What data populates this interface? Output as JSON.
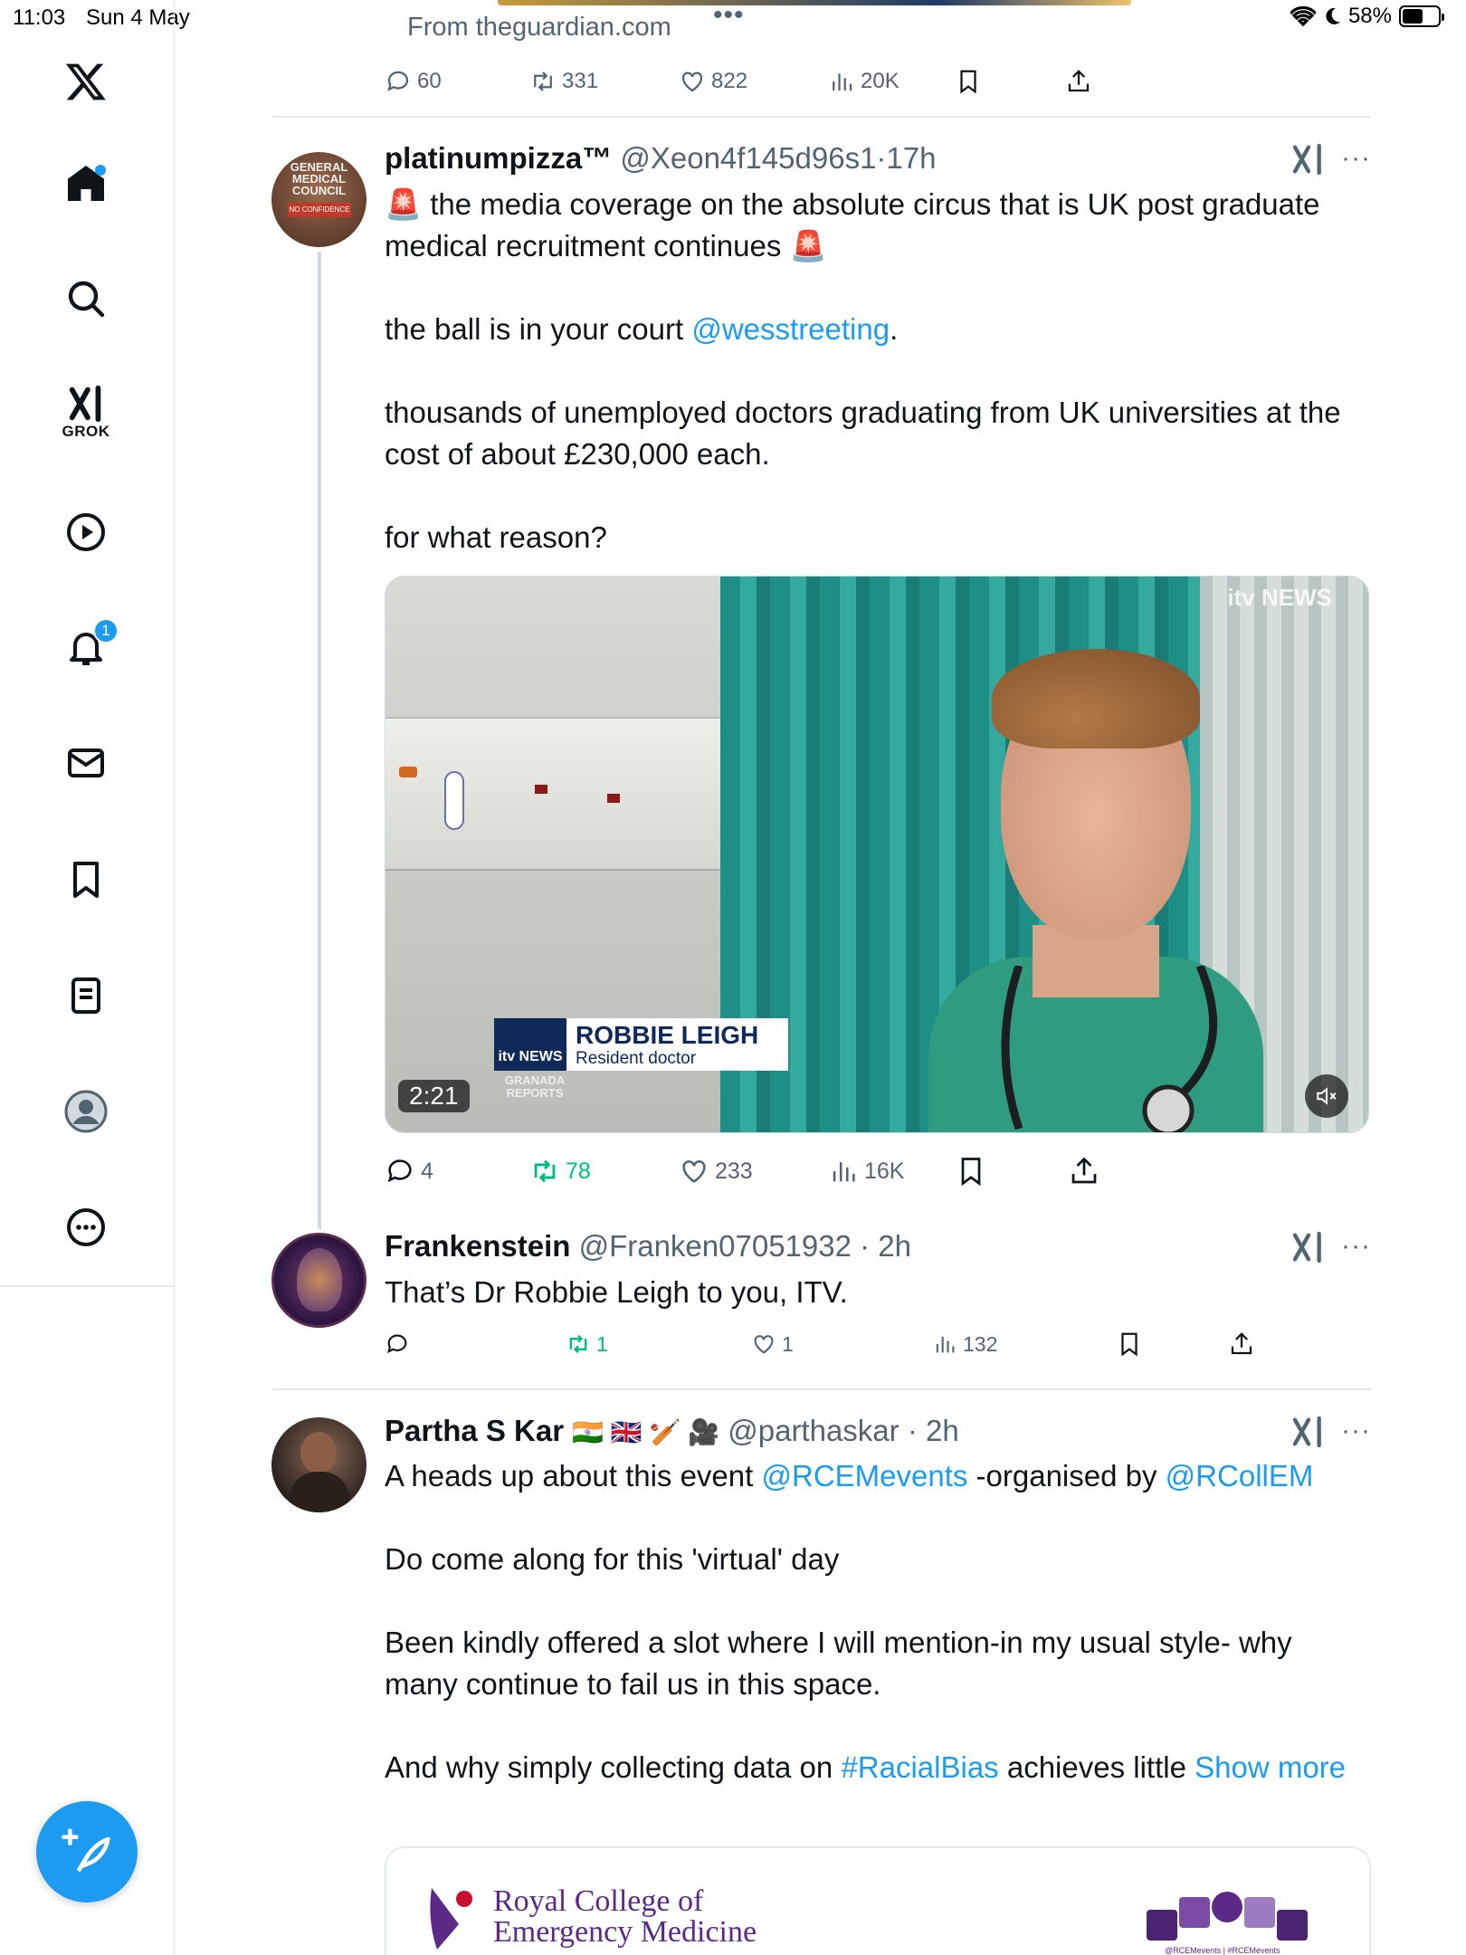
{
  "status": {
    "time": "11:03",
    "date": "Sun 4 May",
    "battery": "58%"
  },
  "sidebar": {
    "grok_label": "GROK",
    "notifications_count": "1"
  },
  "top_tweet": {
    "link_source": "From theguardian.com",
    "replies": "60",
    "reposts": "331",
    "likes": "822",
    "views": "20K"
  },
  "tweet1": {
    "name": "platinumpizza™",
    "handle": "@Xeon4f145d96s1",
    "time": "17h",
    "line1_pre": "🚨 the media coverage on the absolute circus that is UK post graduate",
    "line1_post": "medical recruitment continues 🚨",
    "p2_pre": "the ball is in your court ",
    "p2_link": "@wesstreeting",
    "p2_post": ".",
    "p3": "thousands of unemployed doctors graduating from UK universities at the cost of about £230,000 each.",
    "p4": "for what reason?",
    "video": {
      "duration": "2:21",
      "lower_third_name": "ROBBIE LEIGH",
      "lower_third_role": "Resident doctor",
      "channel": "itv NEWS",
      "sub_channel": "GRANADA REPORTS",
      "watermark": "itv NEWS"
    },
    "replies": "4",
    "reposts": "78",
    "likes": "233",
    "views": "16K"
  },
  "tweet2": {
    "name": "Frankenstein",
    "handle": "@Franken07051932",
    "time": "2h",
    "text": "That’s Dr Robbie Leigh to you, ITV.",
    "replies": "",
    "reposts": "1",
    "likes": "1",
    "views": "132"
  },
  "tweet3": {
    "name": "Partha S Kar",
    "flags": "🇮🇳 🇬🇧 🏏 🎥",
    "handle": "@parthaskar",
    "time": "2h",
    "l1_pre": "A heads up about this event ",
    "l1_link1": "@RCEMevents",
    "l1_mid": " -organised by ",
    "l1_link2": "@RCollEM",
    "p2": "Do come along for this 'virtual' day",
    "p3": "Been kindly offered a slot where I will mention-in my usual style- why many continue to fail us in this space.",
    "p4_pre": "And why simply collecting data on ",
    "p4_link": "#RacialBias",
    "p4_post": " achieves little ",
    "show_more": "Show more",
    "card_title_1": "Royal College of",
    "card_title_2": "Emergency Medicine",
    "card_caption": "@RCEMevents | #RCEMevents"
  }
}
